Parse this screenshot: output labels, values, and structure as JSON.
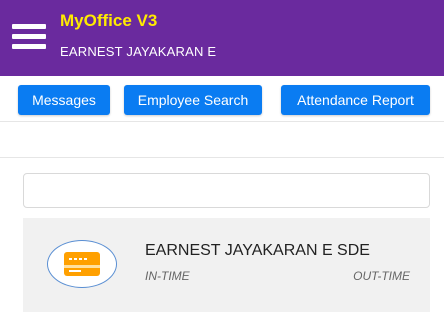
{
  "header": {
    "app_title": "MyOffice V3",
    "user_name": "EARNEST JAYAKARAN E",
    "menu_icon": "hamburger-menu-icon"
  },
  "toolbar": {
    "messages_label": "Messages",
    "employee_search_label": "Employee Search",
    "attendance_report_label": "Attendance Report"
  },
  "search": {
    "value": "",
    "placeholder": ""
  },
  "employee_card": {
    "icon": "id-card-icon",
    "name": "EARNEST JAYAKARAN E SDE",
    "in_time_label": "IN-TIME",
    "out_time_label": "OUT-TIME"
  },
  "colors": {
    "appbar": "#6a2a9e",
    "title": "#ffeb00",
    "button": "#0a7cf2",
    "card_icon": "#ffa000"
  }
}
